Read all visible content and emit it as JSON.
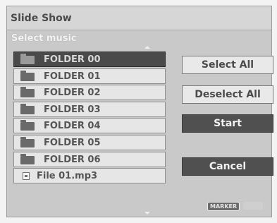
{
  "window": {
    "title": "Slide Show"
  },
  "panel": {
    "subtitle": "Select music"
  },
  "list": {
    "items": [
      {
        "label": "FOLDER 00",
        "type": "folder",
        "selected": true
      },
      {
        "label": "FOLDER 01",
        "type": "folder",
        "selected": false
      },
      {
        "label": "FOLDER 02",
        "type": "folder",
        "selected": false
      },
      {
        "label": "FOLDER 03",
        "type": "folder",
        "selected": false
      },
      {
        "label": "FOLDER 04",
        "type": "folder",
        "selected": false
      },
      {
        "label": "FOLDER 05",
        "type": "folder",
        "selected": false
      },
      {
        "label": "FOLDER 06",
        "type": "folder",
        "selected": false
      },
      {
        "label": "File 01.mp3",
        "type": "file",
        "selected": false
      }
    ]
  },
  "buttons": {
    "select_all": "Select All",
    "deselect_all": "Deselect All",
    "start": "Start",
    "cancel": "Cancel"
  },
  "footer": {
    "marker_label": "MARKER"
  },
  "colors": {
    "selected_row": "#4a4a4a",
    "dark_button": "#505050",
    "panel": "#c9c9c9"
  }
}
